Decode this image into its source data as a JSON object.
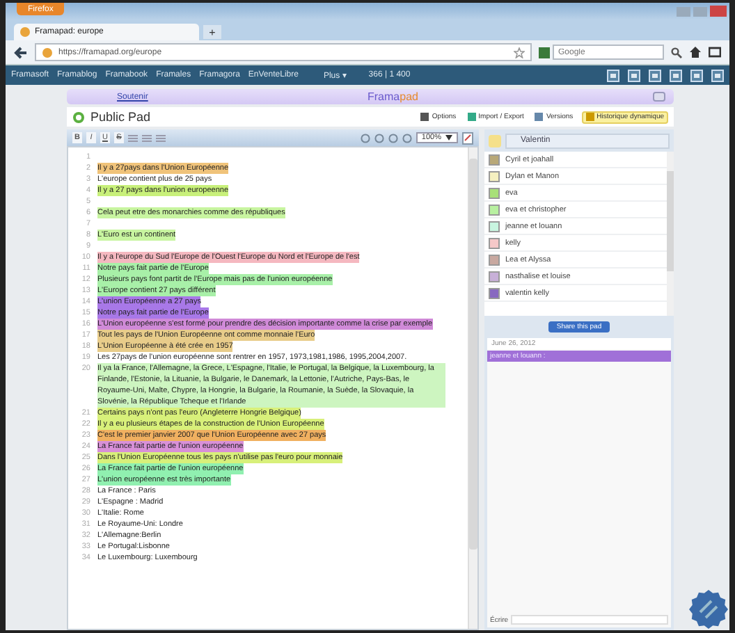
{
  "browser": {
    "app_button": "Firefox",
    "tab": {
      "title": "Framapad: europe"
    },
    "new_tab": "+",
    "address": "https://framapad.org/europe",
    "search": {
      "placeholder": "Google"
    }
  },
  "site_nav": {
    "links": [
      "Framasoft",
      "Framablog",
      "Framabook",
      "Framales",
      "Framagora",
      "EnVenteLibre"
    ],
    "more": "Plus ▾",
    "counter": "366 | 1 400"
  },
  "header": {
    "support_link": "Soutenir",
    "logo_left": "Frama",
    "logo_right": "pad"
  },
  "pad": {
    "title": "Public Pad",
    "actions": [
      {
        "label": "Options",
        "selected": false
      },
      {
        "label": "Import / Export",
        "selected": false
      },
      {
        "label": "Versions",
        "selected": false
      },
      {
        "label": "Historique dynamique",
        "selected": true
      }
    ]
  },
  "toolbar": {
    "format_buttons": [
      "B",
      "I",
      "U",
      "S"
    ],
    "zoom": "100%"
  },
  "editor": {
    "lines": [
      {
        "number": "1"
      },
      {
        "number": "2",
        "text": "Il y a 27pays dans l'Union Européenne",
        "color": "#f0c37a"
      },
      {
        "number": "3",
        "text": "L'europe contient plus de 25 pays"
      },
      {
        "number": "4",
        "text": "Il y a 27 pays dans l'union europeenne",
        "color": "#c8f07a"
      },
      {
        "number": "5"
      },
      {
        "number": "6",
        "text": "Cela peut etre des monarchies comme des républiques",
        "color": "#c8f5a0"
      },
      {
        "number": "7"
      },
      {
        "number": "8",
        "text": "L'Euro est un continent",
        "color": "#c8f5a0"
      },
      {
        "number": "9"
      },
      {
        "number": "10",
        "text": "Il y a l'europe du Sud l'Europe de l'Ouest l'Europe du Nord et l'Europe de l'est",
        "color": "#f5b8c0"
      },
      {
        "number": "11",
        "text": "Notre pays fait partie de l'Europe",
        "color": "#a8f0a8"
      },
      {
        "number": "12",
        "text": "Plusieurs pays font partit de l'Europe mais pas de l'union européenne",
        "color": "#a8f0a8"
      },
      {
        "number": "13",
        "text": "L'Europe contient 27 pays différent",
        "color": "#a8f0a8"
      },
      {
        "number": "14",
        "text": "L'union Européenne a 27 pays",
        "color": "#a878e8"
      },
      {
        "number": "15",
        "text": "Notre pays fait partie de l'Europe",
        "color": "#a878e8"
      },
      {
        "number": "16",
        "text": "L'Union européenne s'est formé pour prendre des décision importante comme la crise par exemple",
        "color": "#d08ad8"
      },
      {
        "number": "17",
        "text": "Tout les pays de l'Union Européenne ont comme monnaie l'Euro",
        "color": "#e8cc8a"
      },
      {
        "number": "18",
        "text": "L'Union Européenne à été crée en 1957",
        "color": "#e8cc8a"
      },
      {
        "number": "19",
        "text": "Les 27pays de l'union européenne sont rentrer en 1957, 1973,1981,1986, 1995,2004,2007."
      },
      {
        "number": "20",
        "text": "Il ya la France, l'Allemagne, la Grece, L'Espagne, l'Italie, le Portugal, la Belgique, la Luxembourg, la Finlande, l'Estonie, la Lituanie, la Bulgarie, le Danemark, la Lettonie, l'Autriche, Pays-Bas, le Royaume-Uni, Malte, Chypre, la Hongrie, la Bulgarie, la Roumanie, la Suède, la Slovaquie, la Slovénie, la République Tcheque et l'Irlande",
        "color": "#cdf5c0"
      },
      {
        "number": "21",
        "text": "Certains pays n'ont pas l'euro (Angleterre Hongrie Belgique)",
        "color": "#d8f07a"
      },
      {
        "number": "22",
        "text": "Il y a eu plusieurs étapes de la construction de l'Union Européenne",
        "color": "#d8f07a"
      },
      {
        "number": "23",
        "text": "C'est le premier janvier 2007 que l'Union Européenne avec 27 pays",
        "color": "#f0b060"
      },
      {
        "number": "24",
        "text": "La France fait partie de l'union européenne",
        "color": "#d890d8"
      },
      {
        "number": "25",
        "text": "Dans l'Union Européenne tous les pays n'utilise pas l'euro pour monnaie",
        "color": "#d8f07a"
      },
      {
        "number": "26",
        "text": "La France fait partie de l'union européenne",
        "color": "#90f0b0"
      },
      {
        "number": "27",
        "text": "L'union européenne est très importante",
        "color": "#90f0b0"
      },
      {
        "number": "28",
        "text": "La France : Paris"
      },
      {
        "number": "29",
        "text": "L'Espagne : Madrid"
      },
      {
        "number": "30",
        "text": "L'Italie: Rome"
      },
      {
        "number": "31",
        "text": "Le Royaume-Uni: Londre"
      },
      {
        "number": "32",
        "text": "L'Allemagne:Berlin"
      },
      {
        "number": "33",
        "text": "Le Portugal:Lisbonne"
      },
      {
        "number": "34",
        "text": "Le Luxembourg: Luxembourg"
      }
    ]
  },
  "users": {
    "me": {
      "name": "Valentin",
      "color": "#f5e08a"
    },
    "list": [
      {
        "name": "Cyril et joahall",
        "color": "#b8a878"
      },
      {
        "name": "Dylan et Manon",
        "color": "#f5f0c0"
      },
      {
        "name": "eva",
        "color": "#a8e078"
      },
      {
        "name": "eva et christopher",
        "color": "#b8f0a0"
      },
      {
        "name": "jeanne et louann",
        "color": "#c8f5e0"
      },
      {
        "name": "kelly",
        "color": "#f5c8c8"
      },
      {
        "name": "Lea et Alyssa",
        "color": "#c8a8a0"
      },
      {
        "name": "nasthalise et louise",
        "color": "#c8b0d8"
      },
      {
        "name": "valentin kelly",
        "color": "#8868c0"
      }
    ]
  },
  "share_button": "Share this pad",
  "chat": {
    "date": "June 26, 2012",
    "messages": [
      {
        "author": "jeanne et louann :",
        "color": "#a070d8"
      }
    ],
    "input_label": "Écrire"
  }
}
